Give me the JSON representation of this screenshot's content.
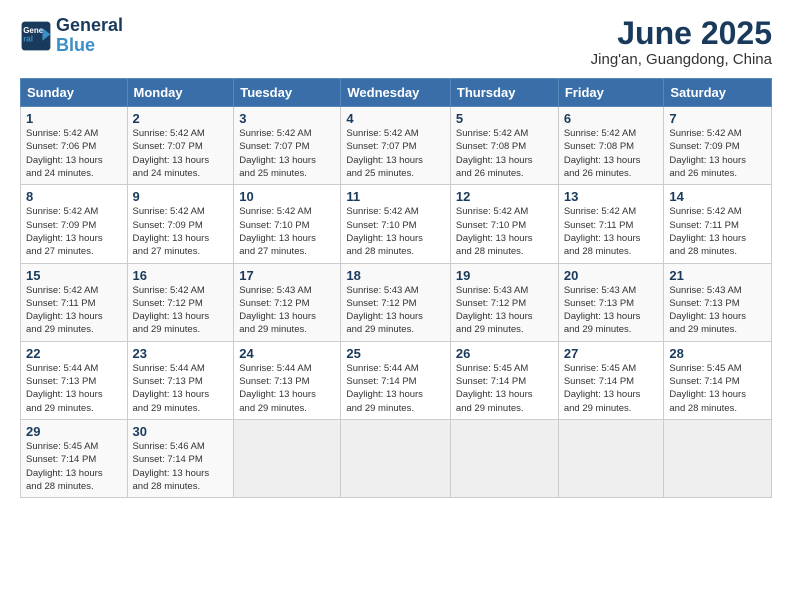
{
  "logo": {
    "line1": "General",
    "line2": "Blue"
  },
  "title": "June 2025",
  "subtitle": "Jing'an, Guangdong, China",
  "days_of_week": [
    "Sunday",
    "Monday",
    "Tuesday",
    "Wednesday",
    "Thursday",
    "Friday",
    "Saturday"
  ],
  "weeks": [
    [
      {
        "day": 1,
        "info": "Sunrise: 5:42 AM\nSunset: 7:06 PM\nDaylight: 13 hours\nand 24 minutes."
      },
      {
        "day": 2,
        "info": "Sunrise: 5:42 AM\nSunset: 7:07 PM\nDaylight: 13 hours\nand 24 minutes."
      },
      {
        "day": 3,
        "info": "Sunrise: 5:42 AM\nSunset: 7:07 PM\nDaylight: 13 hours\nand 25 minutes."
      },
      {
        "day": 4,
        "info": "Sunrise: 5:42 AM\nSunset: 7:07 PM\nDaylight: 13 hours\nand 25 minutes."
      },
      {
        "day": 5,
        "info": "Sunrise: 5:42 AM\nSunset: 7:08 PM\nDaylight: 13 hours\nand 26 minutes."
      },
      {
        "day": 6,
        "info": "Sunrise: 5:42 AM\nSunset: 7:08 PM\nDaylight: 13 hours\nand 26 minutes."
      },
      {
        "day": 7,
        "info": "Sunrise: 5:42 AM\nSunset: 7:09 PM\nDaylight: 13 hours\nand 26 minutes."
      }
    ],
    [
      {
        "day": 8,
        "info": "Sunrise: 5:42 AM\nSunset: 7:09 PM\nDaylight: 13 hours\nand 27 minutes."
      },
      {
        "day": 9,
        "info": "Sunrise: 5:42 AM\nSunset: 7:09 PM\nDaylight: 13 hours\nand 27 minutes."
      },
      {
        "day": 10,
        "info": "Sunrise: 5:42 AM\nSunset: 7:10 PM\nDaylight: 13 hours\nand 27 minutes."
      },
      {
        "day": 11,
        "info": "Sunrise: 5:42 AM\nSunset: 7:10 PM\nDaylight: 13 hours\nand 28 minutes."
      },
      {
        "day": 12,
        "info": "Sunrise: 5:42 AM\nSunset: 7:10 PM\nDaylight: 13 hours\nand 28 minutes."
      },
      {
        "day": 13,
        "info": "Sunrise: 5:42 AM\nSunset: 7:11 PM\nDaylight: 13 hours\nand 28 minutes."
      },
      {
        "day": 14,
        "info": "Sunrise: 5:42 AM\nSunset: 7:11 PM\nDaylight: 13 hours\nand 28 minutes."
      }
    ],
    [
      {
        "day": 15,
        "info": "Sunrise: 5:42 AM\nSunset: 7:11 PM\nDaylight: 13 hours\nand 29 minutes."
      },
      {
        "day": 16,
        "info": "Sunrise: 5:42 AM\nSunset: 7:12 PM\nDaylight: 13 hours\nand 29 minutes."
      },
      {
        "day": 17,
        "info": "Sunrise: 5:43 AM\nSunset: 7:12 PM\nDaylight: 13 hours\nand 29 minutes."
      },
      {
        "day": 18,
        "info": "Sunrise: 5:43 AM\nSunset: 7:12 PM\nDaylight: 13 hours\nand 29 minutes."
      },
      {
        "day": 19,
        "info": "Sunrise: 5:43 AM\nSunset: 7:12 PM\nDaylight: 13 hours\nand 29 minutes."
      },
      {
        "day": 20,
        "info": "Sunrise: 5:43 AM\nSunset: 7:13 PM\nDaylight: 13 hours\nand 29 minutes."
      },
      {
        "day": 21,
        "info": "Sunrise: 5:43 AM\nSunset: 7:13 PM\nDaylight: 13 hours\nand 29 minutes."
      }
    ],
    [
      {
        "day": 22,
        "info": "Sunrise: 5:44 AM\nSunset: 7:13 PM\nDaylight: 13 hours\nand 29 minutes."
      },
      {
        "day": 23,
        "info": "Sunrise: 5:44 AM\nSunset: 7:13 PM\nDaylight: 13 hours\nand 29 minutes."
      },
      {
        "day": 24,
        "info": "Sunrise: 5:44 AM\nSunset: 7:13 PM\nDaylight: 13 hours\nand 29 minutes."
      },
      {
        "day": 25,
        "info": "Sunrise: 5:44 AM\nSunset: 7:14 PM\nDaylight: 13 hours\nand 29 minutes."
      },
      {
        "day": 26,
        "info": "Sunrise: 5:45 AM\nSunset: 7:14 PM\nDaylight: 13 hours\nand 29 minutes."
      },
      {
        "day": 27,
        "info": "Sunrise: 5:45 AM\nSunset: 7:14 PM\nDaylight: 13 hours\nand 29 minutes."
      },
      {
        "day": 28,
        "info": "Sunrise: 5:45 AM\nSunset: 7:14 PM\nDaylight: 13 hours\nand 28 minutes."
      }
    ],
    [
      {
        "day": 29,
        "info": "Sunrise: 5:45 AM\nSunset: 7:14 PM\nDaylight: 13 hours\nand 28 minutes."
      },
      {
        "day": 30,
        "info": "Sunrise: 5:46 AM\nSunset: 7:14 PM\nDaylight: 13 hours\nand 28 minutes."
      },
      null,
      null,
      null,
      null,
      null
    ]
  ]
}
